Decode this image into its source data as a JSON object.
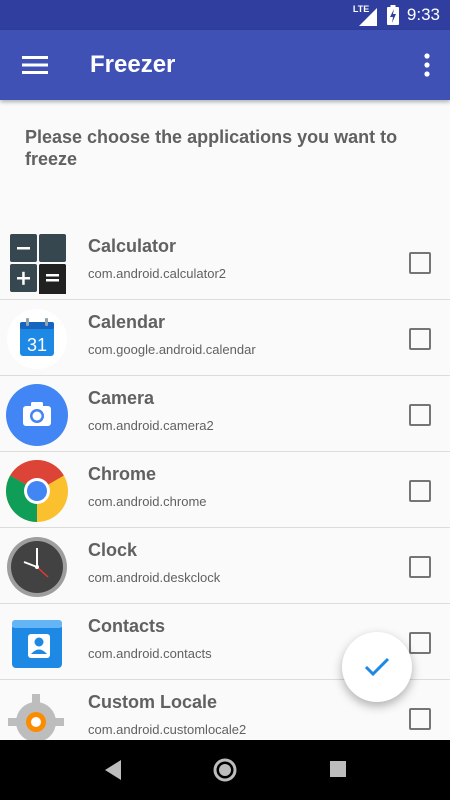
{
  "status_bar": {
    "network": "LTE",
    "time": "9:33"
  },
  "app_bar": {
    "title": "Freezer",
    "menu_icon": "hamburger-menu-icon",
    "overflow_icon": "more-vert-icon"
  },
  "instruction": "Please choose the applications you want to freeze",
  "apps": [
    {
      "name": "Calculator",
      "package": "com.android.calculator2",
      "icon": "calculator-icon",
      "checked": false
    },
    {
      "name": "Calendar",
      "package": "com.google.android.calendar",
      "icon": "calendar-icon",
      "checked": false
    },
    {
      "name": "Camera",
      "package": "com.android.camera2",
      "icon": "camera-icon",
      "checked": false
    },
    {
      "name": "Chrome",
      "package": "com.android.chrome",
      "icon": "chrome-icon",
      "checked": false
    },
    {
      "name": "Clock",
      "package": "com.android.deskclock",
      "icon": "clock-icon",
      "checked": false
    },
    {
      "name": "Contacts",
      "package": "com.android.contacts",
      "icon": "contacts-icon",
      "checked": false
    },
    {
      "name": "Custom Locale",
      "package": "com.android.customlocale2",
      "icon": "gear-icon",
      "checked": false
    }
  ],
  "calendar_icon_day": "31",
  "fab": {
    "icon": "check-icon"
  },
  "nav": {
    "back": "back-icon",
    "home": "home-icon",
    "recents": "recents-icon"
  },
  "colors": {
    "primary": "#3f51b5",
    "primary_dark": "#303f9f",
    "accent": "#1e88e5",
    "text": "#616161"
  }
}
